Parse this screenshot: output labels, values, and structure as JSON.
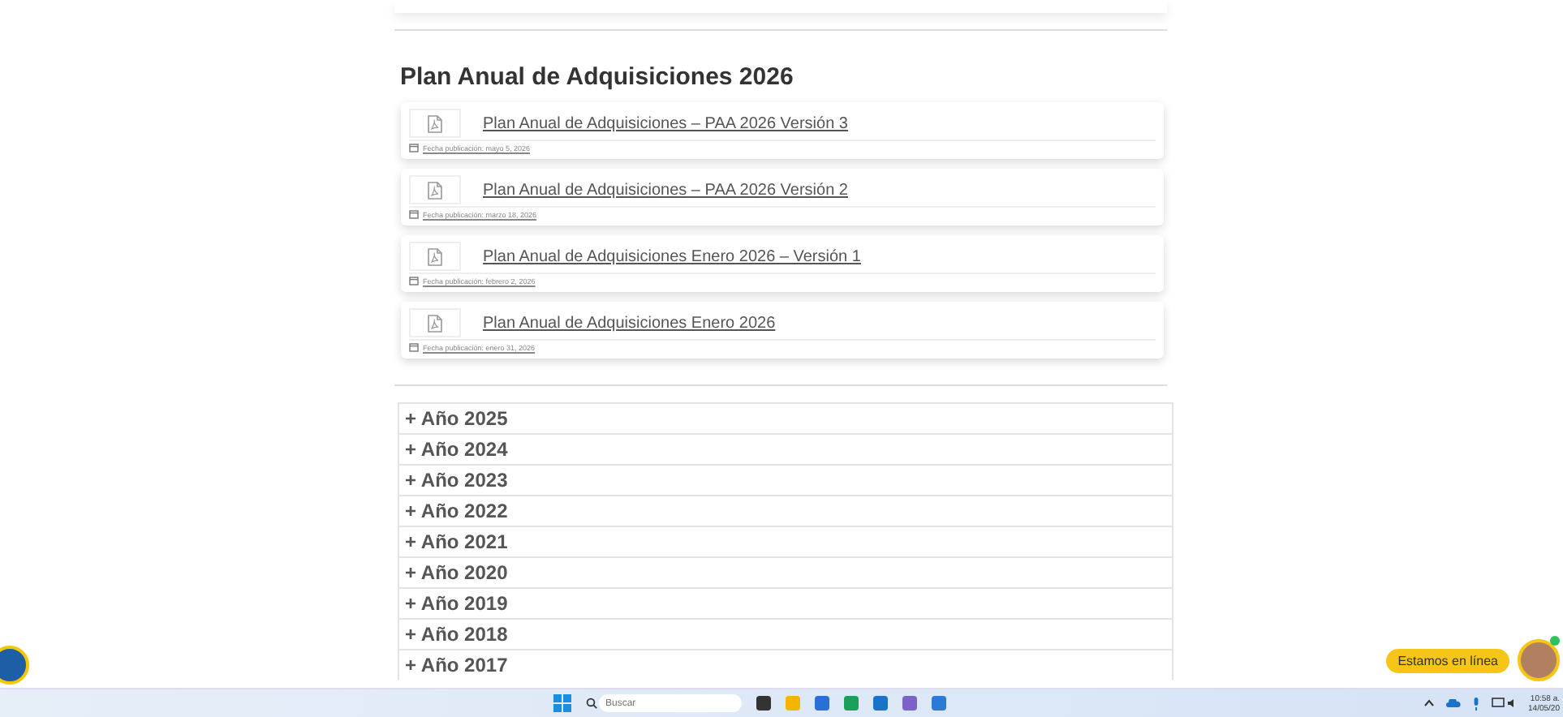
{
  "section": {
    "title": "Plan Anual de Adquisiciones 2026"
  },
  "documents": [
    {
      "title": "Plan Anual de Adquisiciones – PAA 2026 Versión 3",
      "date": "Fecha publicación: mayo 5, 2026"
    },
    {
      "title": "Plan Anual de Adquisiciones – PAA 2026 Versión 2",
      "date": "Fecha publicación: marzo 18, 2026"
    },
    {
      "title": "Plan Anual de Adquisiciones Enero 2026 – Versión 1",
      "date": "Fecha publicación: febrero 2, 2026"
    },
    {
      "title": "Plan Anual de Adquisiciones Enero 2026",
      "date": "Fecha publicación: enero 31, 2026"
    }
  ],
  "years": [
    {
      "label": "+ Año 2025",
      "expanded": false
    },
    {
      "label": "+ Año 2024",
      "expanded": false
    },
    {
      "label": "+ Año 2023",
      "expanded": false
    },
    {
      "label": "+ Año 2022",
      "expanded": false
    },
    {
      "label": "+ Año 2021",
      "expanded": false
    },
    {
      "label": "+ Año 2020",
      "expanded": false
    },
    {
      "label": "+ Año 2019",
      "expanded": false
    },
    {
      "label": "+ Año 2018",
      "expanded": false
    },
    {
      "label": "+ Año 2017",
      "expanded": false
    }
  ],
  "chat": {
    "label": "Estamos en línea"
  },
  "taskbar": {
    "search_placeholder": "Buscar",
    "time": "10:58 a.",
    "date": "14/05/20"
  }
}
